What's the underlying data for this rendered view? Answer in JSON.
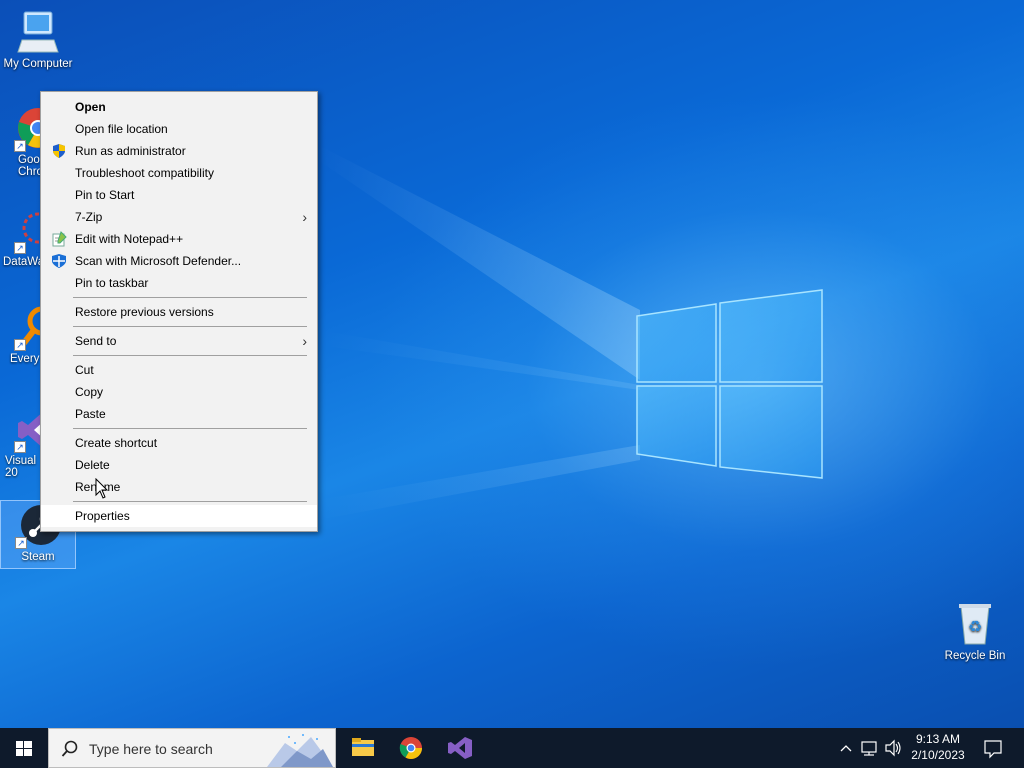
{
  "desktop": {
    "icons": [
      {
        "label": "My Computer"
      },
      {
        "label": "Goo\nChro"
      },
      {
        "label": "DataWa"
      },
      {
        "label": "Every"
      },
      {
        "label": "Visual\n20"
      },
      {
        "label": "Steam"
      },
      {
        "label": "Recycle Bin"
      }
    ]
  },
  "context_menu": {
    "items": [
      {
        "label": "Open"
      },
      {
        "label": "Open file location"
      },
      {
        "label": "Run as administrator",
        "icon": "shield-icon"
      },
      {
        "label": "Troubleshoot compatibility"
      },
      {
        "label": "Pin to Start"
      },
      {
        "label": "7-Zip"
      },
      {
        "label": "Edit with Notepad++",
        "icon": "notepadpp-icon"
      },
      {
        "label": "Scan with Microsoft Defender...",
        "icon": "defender-icon"
      },
      {
        "label": "Pin to taskbar"
      },
      {
        "label": "Restore previous versions"
      },
      {
        "label": "Send to"
      },
      {
        "label": "Cut"
      },
      {
        "label": "Copy"
      },
      {
        "label": "Paste"
      },
      {
        "label": "Create shortcut"
      },
      {
        "label": "Delete"
      },
      {
        "label": "Rename"
      },
      {
        "label": "Properties"
      }
    ]
  },
  "taskbar": {
    "search_placeholder": "Type here to search",
    "apps": [
      "file-explorer-icon",
      "chrome-icon",
      "visual-studio-icon"
    ],
    "clock_time": "9:13 AM",
    "clock_date": "2/10/2023"
  },
  "colors": {
    "accent": "#0a69d6",
    "taskbar": "#0e1a2b",
    "menu_bg": "#f2f2f2"
  }
}
